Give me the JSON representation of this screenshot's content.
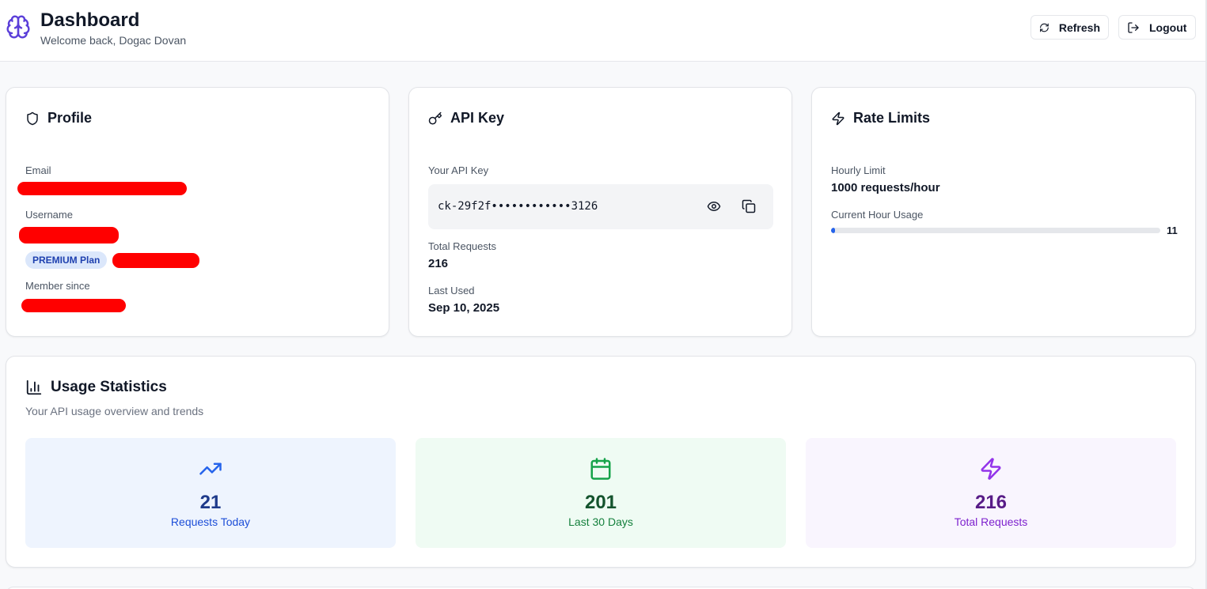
{
  "header": {
    "title": "Dashboard",
    "welcome": "Welcome back, Dogac Dovan",
    "refresh_label": "Refresh",
    "logout_label": "Logout"
  },
  "profile": {
    "title": "Profile",
    "email_label": "Email",
    "username_label": "Username",
    "plan_badge": "PREMIUM Plan",
    "member_since_label": "Member since"
  },
  "api_key": {
    "title": "API Key",
    "your_key_label": "Your API Key",
    "masked_key": "ck-29f2f••••••••••••3126",
    "total_requests_label": "Total Requests",
    "total_requests": "216",
    "last_used_label": "Last Used",
    "last_used": "Sep 10, 2025"
  },
  "rate_limits": {
    "title": "Rate Limits",
    "hourly_limit_label": "Hourly Limit",
    "hourly_limit": "1000 requests/hour",
    "current_usage_label": "Current Hour Usage",
    "current_usage": "11",
    "usage_fraction": 0.011
  },
  "usage": {
    "title": "Usage Statistics",
    "subtitle": "Your API usage overview and trends",
    "tiles": [
      {
        "value": "21",
        "label": "Requests Today",
        "icon": "trending-up-icon",
        "bg": "#eef4fe",
        "color": "#1e3a8a",
        "label_color": "#1d4ed8",
        "icon_color": "#2563eb"
      },
      {
        "value": "201",
        "label": "Last 30 Days",
        "icon": "calendar-icon",
        "bg": "#effbf3",
        "color": "#14532d",
        "label_color": "#15803d",
        "icon_color": "#16a34a"
      },
      {
        "value": "216",
        "label": "Total Requests",
        "icon": "zap-icon",
        "bg": "#f9f5fe",
        "color": "#581c87",
        "label_color": "#7e22ce",
        "icon_color": "#9333ea"
      }
    ]
  },
  "colors": {
    "accent": "#2563eb",
    "brand_icon": "#5b3fd9",
    "redaction": "#ff0000"
  }
}
